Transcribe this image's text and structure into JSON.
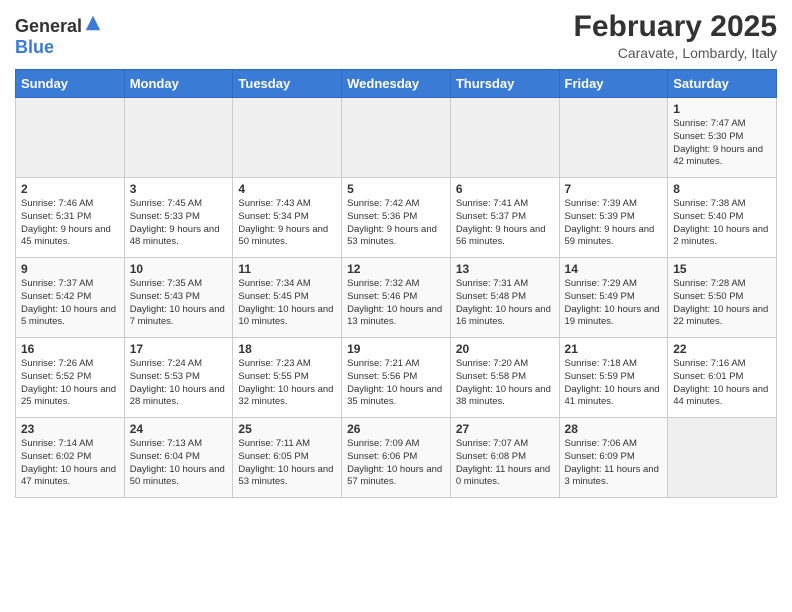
{
  "header": {
    "month_title": "February 2025",
    "location": "Caravate, Lombardy, Italy"
  },
  "columns": [
    "Sunday",
    "Monday",
    "Tuesday",
    "Wednesday",
    "Thursday",
    "Friday",
    "Saturday"
  ],
  "weeks": [
    [
      {
        "day": "",
        "info": ""
      },
      {
        "day": "",
        "info": ""
      },
      {
        "day": "",
        "info": ""
      },
      {
        "day": "",
        "info": ""
      },
      {
        "day": "",
        "info": ""
      },
      {
        "day": "",
        "info": ""
      },
      {
        "day": "1",
        "info": "Sunrise: 7:47 AM\nSunset: 5:30 PM\nDaylight: 9 hours and 42 minutes."
      }
    ],
    [
      {
        "day": "2",
        "info": "Sunrise: 7:46 AM\nSunset: 5:31 PM\nDaylight: 9 hours and 45 minutes."
      },
      {
        "day": "3",
        "info": "Sunrise: 7:45 AM\nSunset: 5:33 PM\nDaylight: 9 hours and 48 minutes."
      },
      {
        "day": "4",
        "info": "Sunrise: 7:43 AM\nSunset: 5:34 PM\nDaylight: 9 hours and 50 minutes."
      },
      {
        "day": "5",
        "info": "Sunrise: 7:42 AM\nSunset: 5:36 PM\nDaylight: 9 hours and 53 minutes."
      },
      {
        "day": "6",
        "info": "Sunrise: 7:41 AM\nSunset: 5:37 PM\nDaylight: 9 hours and 56 minutes."
      },
      {
        "day": "7",
        "info": "Sunrise: 7:39 AM\nSunset: 5:39 PM\nDaylight: 9 hours and 59 minutes."
      },
      {
        "day": "8",
        "info": "Sunrise: 7:38 AM\nSunset: 5:40 PM\nDaylight: 10 hours and 2 minutes."
      }
    ],
    [
      {
        "day": "9",
        "info": "Sunrise: 7:37 AM\nSunset: 5:42 PM\nDaylight: 10 hours and 5 minutes."
      },
      {
        "day": "10",
        "info": "Sunrise: 7:35 AM\nSunset: 5:43 PM\nDaylight: 10 hours and 7 minutes."
      },
      {
        "day": "11",
        "info": "Sunrise: 7:34 AM\nSunset: 5:45 PM\nDaylight: 10 hours and 10 minutes."
      },
      {
        "day": "12",
        "info": "Sunrise: 7:32 AM\nSunset: 5:46 PM\nDaylight: 10 hours and 13 minutes."
      },
      {
        "day": "13",
        "info": "Sunrise: 7:31 AM\nSunset: 5:48 PM\nDaylight: 10 hours and 16 minutes."
      },
      {
        "day": "14",
        "info": "Sunrise: 7:29 AM\nSunset: 5:49 PM\nDaylight: 10 hours and 19 minutes."
      },
      {
        "day": "15",
        "info": "Sunrise: 7:28 AM\nSunset: 5:50 PM\nDaylight: 10 hours and 22 minutes."
      }
    ],
    [
      {
        "day": "16",
        "info": "Sunrise: 7:26 AM\nSunset: 5:52 PM\nDaylight: 10 hours and 25 minutes."
      },
      {
        "day": "17",
        "info": "Sunrise: 7:24 AM\nSunset: 5:53 PM\nDaylight: 10 hours and 28 minutes."
      },
      {
        "day": "18",
        "info": "Sunrise: 7:23 AM\nSunset: 5:55 PM\nDaylight: 10 hours and 32 minutes."
      },
      {
        "day": "19",
        "info": "Sunrise: 7:21 AM\nSunset: 5:56 PM\nDaylight: 10 hours and 35 minutes."
      },
      {
        "day": "20",
        "info": "Sunrise: 7:20 AM\nSunset: 5:58 PM\nDaylight: 10 hours and 38 minutes."
      },
      {
        "day": "21",
        "info": "Sunrise: 7:18 AM\nSunset: 5:59 PM\nDaylight: 10 hours and 41 minutes."
      },
      {
        "day": "22",
        "info": "Sunrise: 7:16 AM\nSunset: 6:01 PM\nDaylight: 10 hours and 44 minutes."
      }
    ],
    [
      {
        "day": "23",
        "info": "Sunrise: 7:14 AM\nSunset: 6:02 PM\nDaylight: 10 hours and 47 minutes."
      },
      {
        "day": "24",
        "info": "Sunrise: 7:13 AM\nSunset: 6:04 PM\nDaylight: 10 hours and 50 minutes."
      },
      {
        "day": "25",
        "info": "Sunrise: 7:11 AM\nSunset: 6:05 PM\nDaylight: 10 hours and 53 minutes."
      },
      {
        "day": "26",
        "info": "Sunrise: 7:09 AM\nSunset: 6:06 PM\nDaylight: 10 hours and 57 minutes."
      },
      {
        "day": "27",
        "info": "Sunrise: 7:07 AM\nSunset: 6:08 PM\nDaylight: 11 hours and 0 minutes."
      },
      {
        "day": "28",
        "info": "Sunrise: 7:06 AM\nSunset: 6:09 PM\nDaylight: 11 hours and 3 minutes."
      },
      {
        "day": "",
        "info": ""
      }
    ]
  ]
}
